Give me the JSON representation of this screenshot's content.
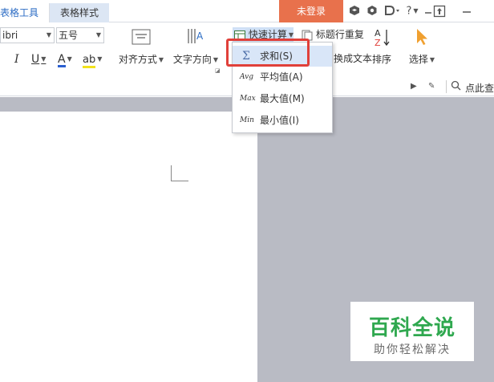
{
  "tabs": [
    {
      "label": "表格工具"
    },
    {
      "label": "表格样式"
    }
  ],
  "login_label": "未登录",
  "top_icons": [
    "cube-icon",
    "hexagon-icon",
    "d-icon",
    "help-icon",
    "minimize-icon",
    "upload-icon",
    "window-minimize-icon"
  ],
  "top_help_label": "?",
  "font": {
    "name": "ibri",
    "size": "五号"
  },
  "ribbon": {
    "align_label": "对齐方式",
    "direction_label": "文字方向",
    "quick_calc_label": "快速计算",
    "header_repeat_label": "标题行重复",
    "to_text_label": "换成文本",
    "sort_label": "排序",
    "select_label": "选择"
  },
  "search_label": "点此查",
  "menu": {
    "items": [
      {
        "icon": "Σ",
        "label": "求和(S)"
      },
      {
        "icon": "Avg",
        "label": "平均值(A)"
      },
      {
        "icon": "Max",
        "label": "最大值(M)"
      },
      {
        "icon": "Min",
        "label": "最小值(I)"
      }
    ]
  },
  "watermark": {
    "title": "百科全说",
    "subtitle": "助你轻松解决"
  },
  "colors": {
    "accent": "#2b6cc4",
    "login": "#e8714c",
    "highlight": "#e0403a",
    "watermark": "#2fa84f"
  }
}
